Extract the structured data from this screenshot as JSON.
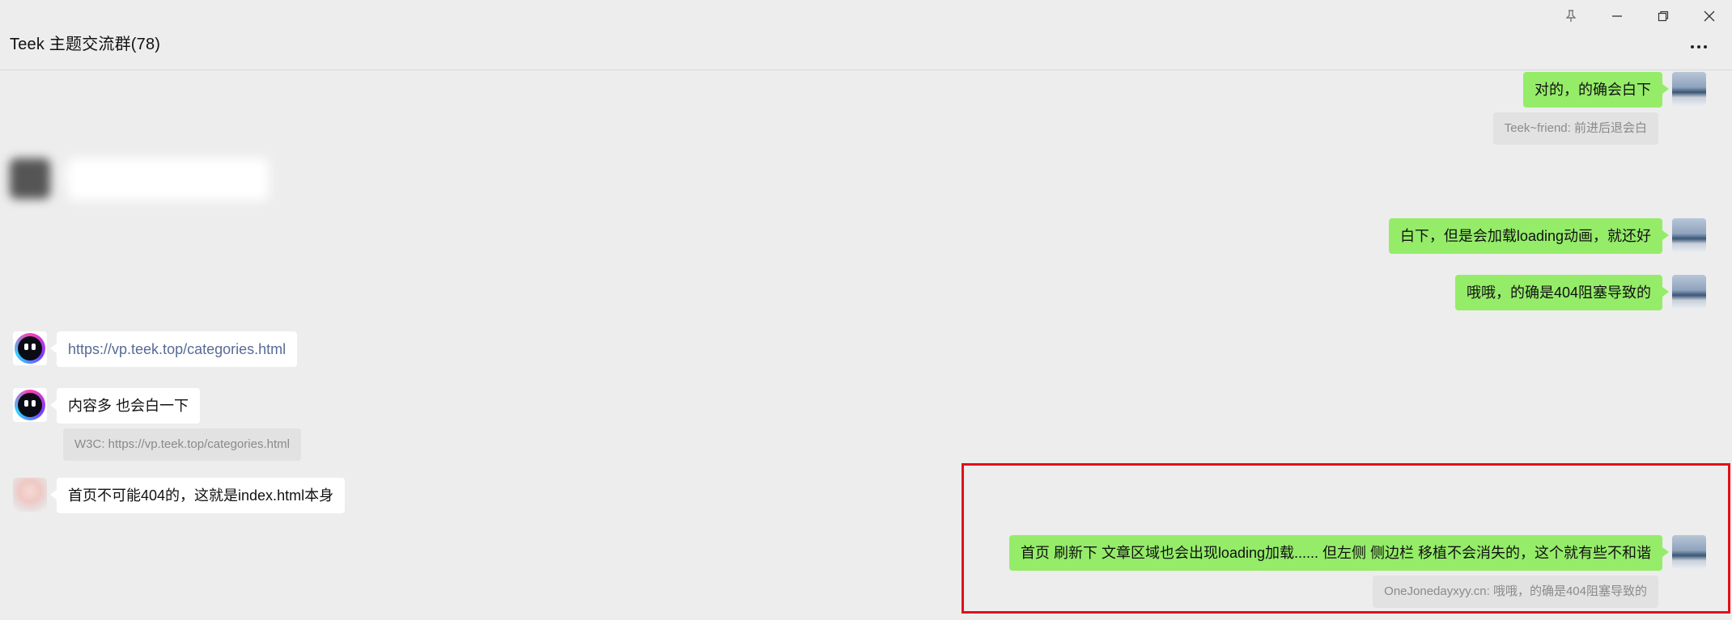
{
  "window": {
    "title": "Teek 主题交流群(78)",
    "controls": {
      "pin_icon": "pin-icon",
      "minimize_icon": "minimize-icon",
      "restore_icon": "restore-icon",
      "close_icon": "close-icon"
    },
    "more_icon": "ellipsis-icon"
  },
  "messages": [
    {
      "side": "right",
      "sender": "me",
      "text": "对的，的确会白下"
    },
    {
      "side": "right",
      "type": "quote",
      "text": "Teek~friend: 前进后退会白"
    },
    {
      "side": "left",
      "sender": "blurred",
      "text": ""
    },
    {
      "side": "right",
      "sender": "me",
      "text": "白下，但是会加载loading动画，就还好"
    },
    {
      "side": "right",
      "sender": "me",
      "text": "哦哦，的确是404阻塞导致的"
    },
    {
      "side": "left",
      "sender": "bot",
      "text": "https://vp.teek.top/categories.html",
      "is_link": true
    },
    {
      "side": "left",
      "sender": "bot",
      "text": "内容多 也会白一下"
    },
    {
      "side": "left",
      "type": "quote",
      "text": "W3C: https://vp.teek.top/categories.html"
    },
    {
      "side": "left",
      "sender": "girl",
      "text": "首页不可能404的，这就是index.html本身"
    },
    {
      "side": "right",
      "sender": "me",
      "text": "首页 刷新下 文章区域也会出现loading加载...... 但左侧 侧边栏 移植不会消失的，这个就有些不和谐"
    },
    {
      "side": "right",
      "type": "quote",
      "text": "OneJonedayxyy.cn: 哦哦，的确是404阻塞导致的"
    }
  ],
  "colors": {
    "background": "#ededed",
    "my_bubble": "#95ec69",
    "their_bubble": "#ffffff",
    "link": "#576b95",
    "quote_bg": "#e2e2e2",
    "highlight": "#e0101a"
  }
}
